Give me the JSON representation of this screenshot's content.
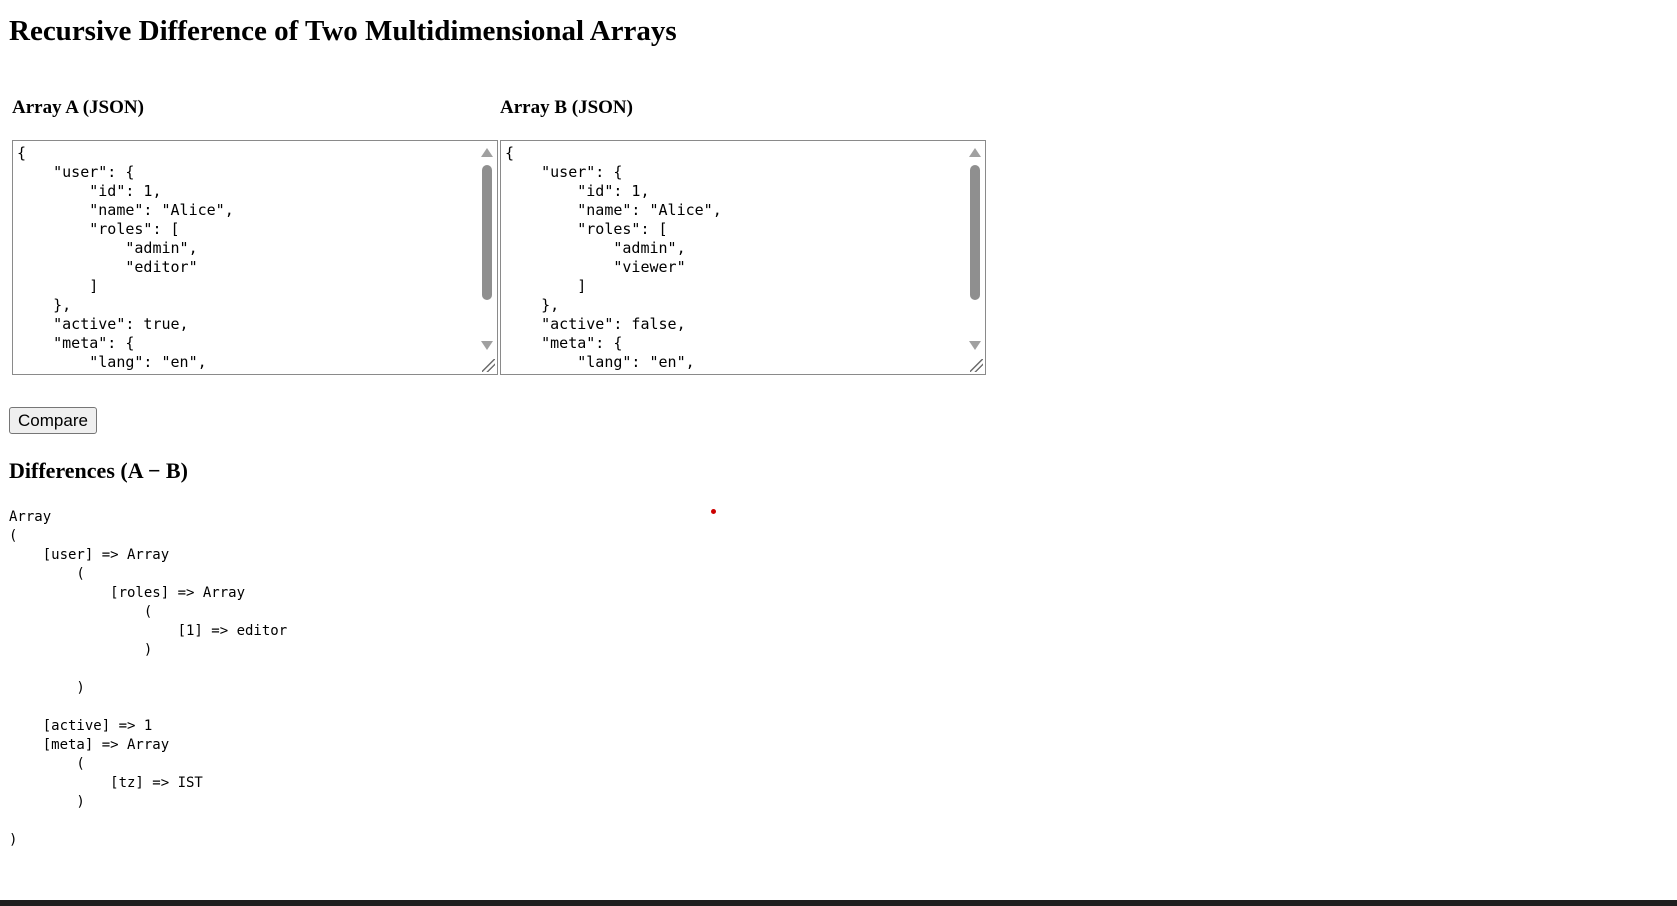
{
  "page": {
    "title": "Recursive Difference of Two Multidimensional Arrays"
  },
  "inputs": {
    "array_a": {
      "label": "Array A (JSON)",
      "value": "{\n    \"user\": {\n        \"id\": 1,\n        \"name\": \"Alice\",\n        \"roles\": [\n            \"admin\",\n            \"editor\"\n        ]\n    },\n    \"active\": true,\n    \"meta\": {\n        \"lang\": \"en\","
    },
    "array_b": {
      "label": "Array B (JSON)",
      "value": "{\n    \"user\": {\n        \"id\": 1,\n        \"name\": \"Alice\",\n        \"roles\": [\n            \"admin\",\n            \"viewer\"\n        ]\n    },\n    \"active\": false,\n    \"meta\": {\n        \"lang\": \"en\","
    }
  },
  "actions": {
    "compare_label": "Compare"
  },
  "results": {
    "heading": "Differences (A − B)",
    "output": "Array\n(\n    [user] => Array\n        (\n            [roles] => Array\n                (\n                    [1] => editor\n                )\n\n        )\n\n    [active] => 1\n    [meta] => Array\n        (\n            [tz] => IST\n        )\n\n)"
  },
  "icons": {
    "scroll_up": "triangle-up-icon",
    "scroll_down": "triangle-down-icon",
    "resize": "resize-grip-icon"
  },
  "colors": {
    "background": "#ffffff",
    "button_background": "#efefef",
    "border": "#8a8a8a",
    "scrollbar_thumb": "#8f8f8f",
    "red_dot": "#cc0000",
    "bottom_bar": "#1f1f1f"
  }
}
